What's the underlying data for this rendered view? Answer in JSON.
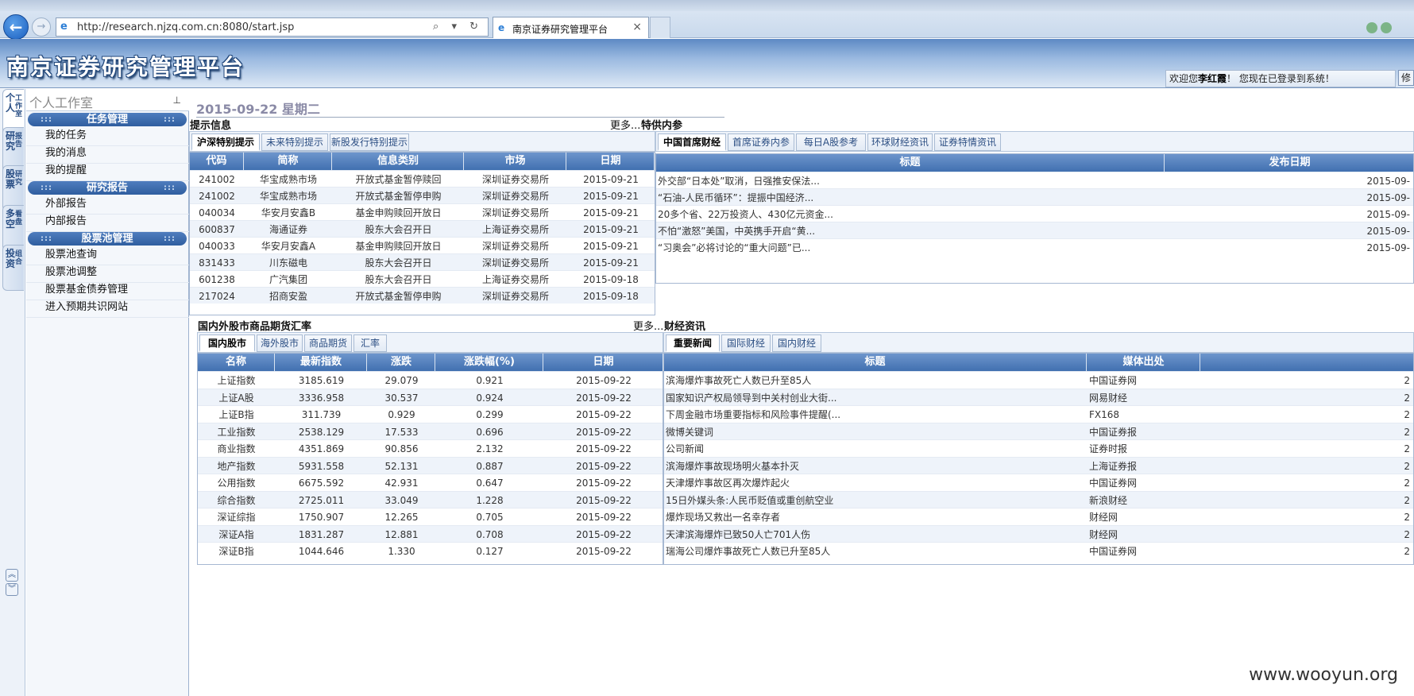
{
  "browser": {
    "url": "http://research.njzq.com.cn:8080/start.jsp",
    "tab_title": "南京证券研究管理平台",
    "tab_close": "×",
    "back": "←",
    "forward": "→",
    "address_tools": "⌕ ▾ ↻"
  },
  "header": {
    "app_title": "南京证券研究管理平台",
    "welcome_prefix": "欢迎您",
    "user_name": "李红霞",
    "welcome_suffix": "！ 您现在已登录到系统！",
    "edit_label": "修"
  },
  "vtabs": [
    {
      "big": "个人",
      "small": "工作室"
    },
    {
      "big": "研究",
      "small": "报告"
    },
    {
      "big": "股票",
      "small": "研究"
    },
    {
      "big": "多空",
      "small": "看盘"
    },
    {
      "big": "投资",
      "small": "组合"
    }
  ],
  "vscroll": {
    "up": "︽",
    "down": "︾"
  },
  "sidebar": {
    "title": "个人工作室",
    "pin": "⊥",
    "groups": [
      {
        "title": "任务管理",
        "items": [
          "我的任务",
          "我的消息",
          "我的提醒"
        ]
      },
      {
        "title": "研究报告",
        "items": [
          "外部报告",
          "内部报告"
        ]
      },
      {
        "title": "股票池管理",
        "items": [
          "股票池查询",
          "股票池调整",
          "股票基金债券管理",
          "进入预期共识网站"
        ]
      }
    ],
    "dots": ":::"
  },
  "main": {
    "date": "2015-09-22 星期二",
    "more": "更多...",
    "tips": {
      "label": "提示信息",
      "tabs": [
        "沪深特别提示",
        "未来特别提示",
        "新股发行特别提示"
      ],
      "columns": [
        "代码",
        "简称",
        "信息类别",
        "市场",
        "日期"
      ],
      "rows": [
        [
          "241002",
          "华宝成熟市场",
          "开放式基金暂停赎回",
          "深圳证券交易所",
          "2015-09-21"
        ],
        [
          "241002",
          "华宝成熟市场",
          "开放式基金暂停申购",
          "深圳证券交易所",
          "2015-09-21"
        ],
        [
          "040034",
          "华安月安鑫B",
          "基金申购赎回开放日",
          "深圳证券交易所",
          "2015-09-21"
        ],
        [
          "600837",
          "海通证券",
          "股东大会召开日",
          "上海证券交易所",
          "2015-09-21"
        ],
        [
          "040033",
          "华安月安鑫A",
          "基金申购赎回开放日",
          "深圳证券交易所",
          "2015-09-21"
        ],
        [
          "831433",
          "川东磁电",
          "股东大会召开日",
          "深圳证券交易所",
          "2015-09-21"
        ],
        [
          "601238",
          "广汽集团",
          "股东大会召开日",
          "上海证券交易所",
          "2015-09-18"
        ],
        [
          "217024",
          "招商安盈",
          "开放式基金暂停申购",
          "深圳证券交易所",
          "2015-09-18"
        ]
      ]
    },
    "internal": {
      "label": "特供内参",
      "tabs": [
        "中国首席财经",
        "首席证券内参",
        "每日A股参考",
        "环球财经资讯",
        "证券特情资讯"
      ],
      "columns": [
        "标题",
        "发布日期"
      ],
      "rows": [
        [
          "外交部“日本处”取消，日强推安保法...",
          "2015-09-"
        ],
        [
          "“石油-人民币循环”：提振中国经济...",
          "2015-09-"
        ],
        [
          "20多个省、22万投资人、430亿元资金...",
          "2015-09-"
        ],
        [
          "不怕“激怒”美国，中英携手开启“黄...",
          "2015-09-"
        ],
        [
          "“习奥会”必将讨论的“重大问题”已...",
          "2015-09-"
        ]
      ]
    },
    "markets": {
      "label": "国内外股市商品期货汇率",
      "tabs": [
        "国内股市",
        "海外股市",
        "商品期货",
        "汇率"
      ],
      "columns": [
        "名称",
        "最新指数",
        "涨跌",
        "涨跌幅(%)",
        "日期"
      ],
      "rows": [
        [
          "上证指数",
          "3185.619",
          "29.079",
          "0.921",
          "2015-09-22"
        ],
        [
          "上证A股",
          "3336.958",
          "30.537",
          "0.924",
          "2015-09-22"
        ],
        [
          "上证B指",
          "311.739",
          "0.929",
          "0.299",
          "2015-09-22"
        ],
        [
          "工业指数",
          "2538.129",
          "17.533",
          "0.696",
          "2015-09-22"
        ],
        [
          "商业指数",
          "4351.869",
          "90.856",
          "2.132",
          "2015-09-22"
        ],
        [
          "地产指数",
          "5931.558",
          "52.131",
          "0.887",
          "2015-09-22"
        ],
        [
          "公用指数",
          "6675.592",
          "42.931",
          "0.647",
          "2015-09-22"
        ],
        [
          "综合指数",
          "2725.011",
          "33.049",
          "1.228",
          "2015-09-22"
        ],
        [
          "深证综指",
          "1750.907",
          "12.265",
          "0.705",
          "2015-09-22"
        ],
        [
          "深证A指",
          "1831.287",
          "12.881",
          "0.708",
          "2015-09-22"
        ],
        [
          "深证B指",
          "1044.646",
          "1.330",
          "0.127",
          "2015-09-22"
        ]
      ]
    },
    "news": {
      "label": "财经资讯",
      "tabs": [
        "重要新闻",
        "国际财经",
        "国内财经"
      ],
      "columns": [
        "标题",
        "媒体出处",
        ""
      ],
      "rows": [
        [
          "滨海爆炸事故死亡人数已升至85人",
          "中国证券网",
          "2"
        ],
        [
          "国家知识产权局领导到中关村创业大街...",
          "网易财经",
          "2"
        ],
        [
          "下周金融市场重要指标和风险事件提醒(...",
          "FX168",
          "2"
        ],
        [
          "微博关键词",
          "中国证券报",
          "2"
        ],
        [
          "公司新闻",
          "证券时报",
          "2"
        ],
        [
          "滨海爆炸事故现场明火基本扑灭",
          "上海证券报",
          "2"
        ],
        [
          "天津爆炸事故区再次爆炸起火",
          "中国证券网",
          "2"
        ],
        [
          "15日外媒头条:人民币贬值或重创航空业",
          "新浪财经",
          "2"
        ],
        [
          "爆炸现场又救出一名幸存者",
          "财经网",
          "2"
        ],
        [
          "天津滨海爆炸已致50人亡701人伤",
          "财经网",
          "2"
        ],
        [
          "瑞海公司爆炸事故死亡人数已升至85人",
          "中国证券网",
          "2"
        ]
      ]
    }
  },
  "watermark": "www.wooyun.org"
}
